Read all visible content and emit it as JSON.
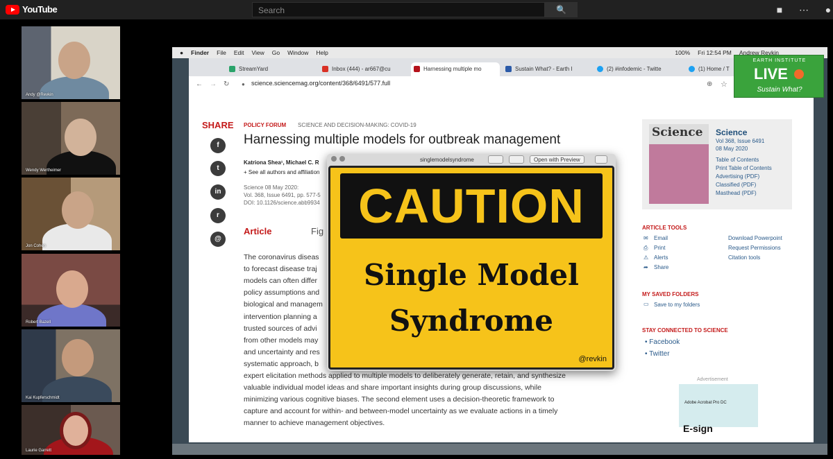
{
  "youtube": {
    "logo": "YouTube",
    "search_placeholder": "Search",
    "search_icon": "search-icon",
    "icons": [
      "video-camera-icon",
      "apps-grid-icon",
      "notification-bell-icon"
    ]
  },
  "participants": [
    {
      "name": "Andy @Revkin"
    },
    {
      "name": "Wendy Wertheimer"
    },
    {
      "name": "Jon Cohen"
    },
    {
      "name": "Robert Bazell"
    },
    {
      "name": "Kai Kupferschmidt"
    },
    {
      "name": "Laurie Garrett"
    }
  ],
  "mac_menu": {
    "items": [
      "Finder",
      "File",
      "Edit",
      "View",
      "Go",
      "Window",
      "Help"
    ],
    "battery": "100%",
    "clock": "Fri 12:54 PM",
    "user": "Andrew Revkin"
  },
  "browser": {
    "tabs": [
      {
        "label": "StreamYard",
        "active": false
      },
      {
        "label": "Inbox (444) - ar667@cu",
        "active": false
      },
      {
        "label": "Harnessing multiple mo",
        "active": true
      },
      {
        "label": "Sustain What? - Earth I",
        "active": false
      },
      {
        "label": "(2) #infodemic - Twitte",
        "active": false
      },
      {
        "label": "(1) Home / T",
        "active": false
      }
    ],
    "url": "science.sciencemag.org/content/368/6491/577.full"
  },
  "article": {
    "share_label": "SHARE",
    "section": "POLICY FORUM",
    "category": "SCIENCE AND DECISION-MAKING: COVID-19",
    "title": "Harnessing multiple models for outbreak management",
    "authors": "Katriona Shea¹, Michael C. R",
    "authors_more": "+ See all authors and affiliation",
    "citation_journal": "Science  08 May 2020:",
    "citation_vol": "Vol. 368, Issue 6491, pp. 577-5",
    "citation_doi": "DOI: 10.1126/science.abb9934",
    "tab_article": "Article",
    "tab_figures": "Fig",
    "body_lines": [
      "The coronavirus diseas",
      "to forecast disease traj",
      "models can often differ",
      "policy assumptions and",
      "biological and managem",
      "intervention planning a",
      "trusted sources of advi",
      "from other models may",
      "and uncertainty and res",
      "systematic approach, b",
      "expert elicitation methods applied to multiple models to deliberately generate, retain, and synthesize",
      "valuable individual model ideas and share important insights during group discussions, while",
      "minimizing various cognitive biases. The second element uses a decision-theoretic framework to",
      "capture and account for within- and between-model uncertainty as we evaluate actions in a timely",
      "manner to achieve management objectives."
    ]
  },
  "sidebar": {
    "journal": "Science",
    "volume": "Vol 368, Issue 6491",
    "date": "08 May 2020",
    "links": [
      "Table of Contents",
      "Print Table of Contents",
      "Advertising (PDF)",
      "Classified (PDF)",
      "Masthead (PDF)"
    ],
    "tools_header": "ARTICLE TOOLS",
    "tools_left": [
      "Email",
      "Print",
      "Alerts",
      "Share"
    ],
    "tools_right": [
      "Download Powerpoint",
      "Request Permissions",
      "Citation tools"
    ],
    "saved_header": "MY SAVED FOLDERS",
    "saved_link": "Save to my folders",
    "connected_header": "STAY CONNECTED TO SCIENCE",
    "connected_links": [
      "Facebook",
      "Twitter"
    ],
    "ad_label": "Advertisement",
    "ad_product": "Adobe Acrobat Pro DC",
    "ad_headline": "E-sign"
  },
  "quicklook": {
    "filename": "singlemodelsyndrome",
    "open_button": "Open with Preview",
    "caution": "CAUTION",
    "line1": "Single Model",
    "line2": "Syndrome",
    "handle": "@revkin"
  },
  "live_badge": {
    "org": "EARTH INSTITUTE",
    "label": "LIVE",
    "show": "Sustain What?"
  }
}
